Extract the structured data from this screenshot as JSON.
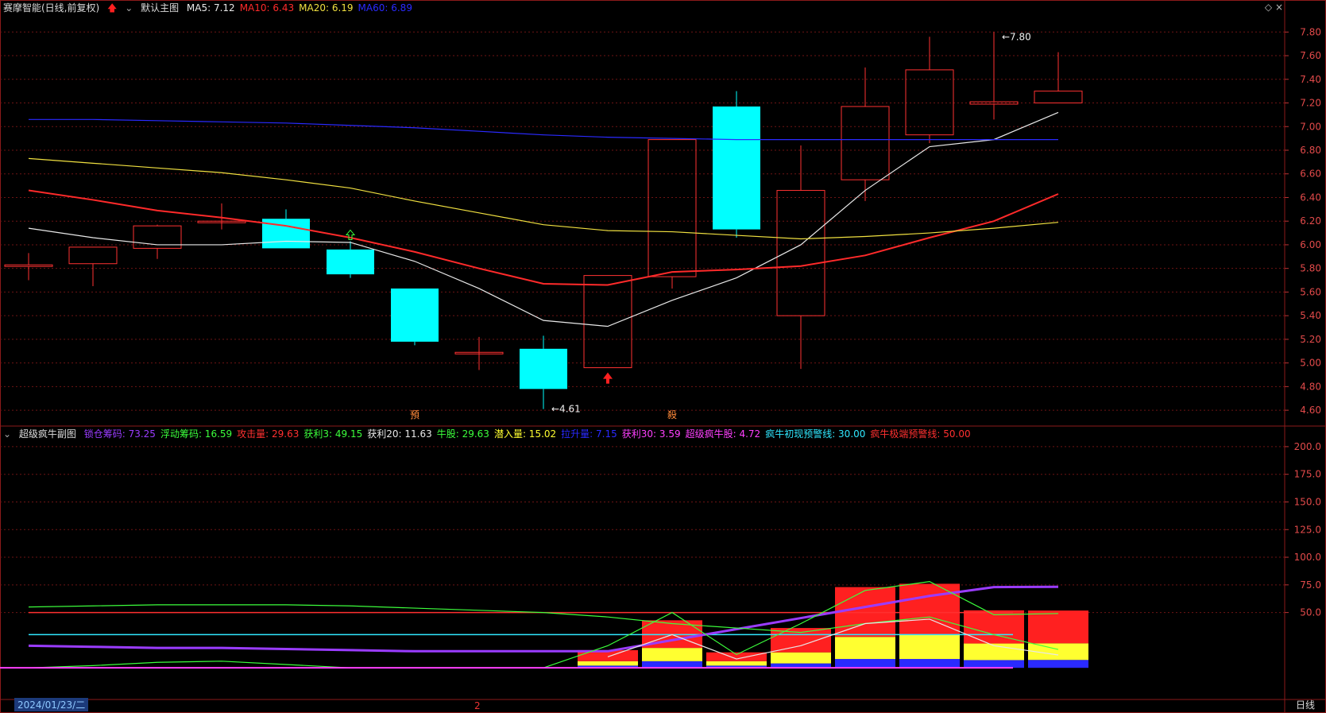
{
  "main_header": {
    "stock_title": "赛摩智能(日线,前复权)",
    "chart_name": "默认主图",
    "indicators": [
      {
        "label": "MA5: 7.12",
        "color": "#e8e8e8"
      },
      {
        "label": "MA10: 6.43",
        "color": "#ff2a2a"
      },
      {
        "label": "MA20: 6.19",
        "color": "#f0e040"
      },
      {
        "label": "MA60: 6.89",
        "color": "#2a2aff"
      }
    ]
  },
  "sub_header": {
    "chart_name": "超级疯牛副图",
    "indicators": [
      {
        "label": "锁仓筹码: 73.25",
        "color": "#9a3cff"
      },
      {
        "label": "浮动筹码: 16.59",
        "color": "#3cff3c"
      },
      {
        "label": "攻击量: 29.63",
        "color": "#ff3030"
      },
      {
        "label": "获利3: 49.15",
        "color": "#3cff3c"
      },
      {
        "label": "获利20: 11.63",
        "color": "#e8e8e8"
      },
      {
        "label": "牛股: 29.63",
        "color": "#3cff3c"
      },
      {
        "label": "潜入量: 15.02",
        "color": "#ffff30"
      },
      {
        "label": "拉升量: 7.15",
        "color": "#2a2aff"
      },
      {
        "label": "获利30: 3.59",
        "color": "#ff40ff"
      },
      {
        "label": "超级疯牛股: 4.72",
        "color": "#ff40ff"
      },
      {
        "label": "疯牛初现预警线: 30.00",
        "color": "#30e8ff"
      },
      {
        "label": "疯牛极端预警线: 50.00",
        "color": "#ff3030"
      }
    ]
  },
  "footer": {
    "date": "2024/01/23/二",
    "period_mark": "2",
    "period": "日线"
  },
  "chart_data": [
    {
      "type": "candlestick",
      "y_axis_ticks": [
        "7.80",
        "7.60",
        "7.40",
        "7.20",
        "7.00",
        "6.80",
        "6.60",
        "6.40",
        "6.20",
        "6.00",
        "5.80",
        "5.60",
        "5.40",
        "5.20",
        "5.00",
        "4.80",
        "4.60"
      ],
      "ylim": [
        4.52,
        7.95
      ],
      "candles": [
        {
          "o": 5.82,
          "h": 5.93,
          "l": 5.7,
          "c": 5.83
        },
        {
          "o": 5.84,
          "h": 5.98,
          "l": 5.65,
          "c": 5.98
        },
        {
          "o": 5.97,
          "h": 6.17,
          "l": 5.88,
          "c": 6.16
        },
        {
          "o": 6.2,
          "h": 6.35,
          "l": 6.13,
          "c": 6.2
        },
        {
          "o": 6.22,
          "h": 6.3,
          "l": 5.97,
          "c": 5.97
        },
        {
          "o": 5.96,
          "h": 6.03,
          "l": 5.72,
          "c": 5.75
        },
        {
          "o": 5.63,
          "h": 5.63,
          "l": 5.15,
          "c": 5.18
        },
        {
          "o": 5.09,
          "h": 5.22,
          "l": 4.94,
          "c": 5.09
        },
        {
          "o": 5.12,
          "h": 5.23,
          "l": 4.61,
          "c": 4.78
        },
        {
          "o": 4.96,
          "h": 5.74,
          "l": 4.96,
          "c": 5.74
        },
        {
          "o": 5.73,
          "h": 6.89,
          "l": 5.63,
          "c": 6.89
        },
        {
          "o": 7.17,
          "h": 7.3,
          "l": 6.06,
          "c": 6.13
        },
        {
          "o": 5.4,
          "h": 6.84,
          "l": 4.95,
          "c": 6.46
        },
        {
          "o": 6.55,
          "h": 7.5,
          "l": 6.37,
          "c": 7.17
        },
        {
          "o": 6.93,
          "h": 7.76,
          "l": 6.86,
          "c": 7.48
        },
        {
          "o": 7.19,
          "h": 7.8,
          "l": 7.06,
          "c": 7.21
        },
        {
          "o": 7.2,
          "h": 7.63,
          "l": 7.2,
          "c": 7.3
        }
      ],
      "series": [
        {
          "name": "MA5",
          "color": "#e8e8e8",
          "values": [
            6.14,
            6.06,
            6.0,
            6.0,
            6.03,
            6.02,
            5.86,
            5.63,
            5.36,
            5.31,
            5.53,
            5.72,
            6.0,
            6.46,
            6.83,
            6.89,
            7.12
          ]
        },
        {
          "name": "MA10",
          "color": "#ff2a2a",
          "values": [
            6.46,
            6.38,
            6.29,
            6.23,
            6.16,
            6.06,
            5.94,
            5.8,
            5.67,
            5.66,
            5.77,
            5.79,
            5.82,
            5.91,
            6.06,
            6.2,
            6.43
          ]
        },
        {
          "name": "MA20",
          "color": "#f0e040",
          "values": [
            6.73,
            6.69,
            6.65,
            6.61,
            6.55,
            6.48,
            6.37,
            6.27,
            6.17,
            6.12,
            6.11,
            6.08,
            6.05,
            6.07,
            6.1,
            6.14,
            6.19
          ]
        },
        {
          "name": "MA60",
          "color": "#2a2aff",
          "values": [
            7.06,
            7.06,
            7.05,
            7.04,
            7.03,
            7.01,
            6.99,
            6.96,
            6.93,
            6.91,
            6.9,
            6.89,
            6.89,
            6.89,
            6.89,
            6.89,
            6.89
          ]
        }
      ],
      "annotations": [
        {
          "text": "7.80",
          "at_candle": 15,
          "price": 7.8
        },
        {
          "text": "4.61",
          "at_candle": 8,
          "price": 4.61
        },
        {
          "text": "預",
          "at_candle": 6,
          "position": "below"
        },
        {
          "text": "殺",
          "at_candle": 10,
          "position": "below"
        }
      ],
      "signals": [
        {
          "kind": "buy-arrow",
          "at_candle": 9,
          "color": "#ff2020"
        },
        {
          "kind": "green-arrow",
          "at_candle": 5,
          "color": "#3cff3c"
        }
      ]
    },
    {
      "type": "line",
      "y_axis_ticks": [
        "200.0",
        "175.0",
        "150.0",
        "125.0",
        "100.0",
        "75.0",
        "50.0"
      ],
      "ylim": [
        -20,
        210
      ],
      "reference_lines": [
        {
          "name": "疯牛极端预警线",
          "value": 50,
          "color": "#ff3030"
        },
        {
          "name": "疯牛初现预警线",
          "value": 30,
          "color": "#30e8ff"
        }
      ],
      "series": [
        {
          "name": "锁仓筹码",
          "color": "#9a3cff",
          "values": [
            20,
            19,
            18,
            18,
            17,
            16,
            15,
            15,
            15,
            15,
            25,
            35,
            45,
            55,
            65,
            73,
            73.25
          ]
        },
        {
          "name": "浮动筹码",
          "color": "#3cff3c",
          "values": [
            55,
            56,
            57,
            57,
            57,
            56,
            54,
            52,
            50,
            46,
            40,
            36,
            32,
            40,
            46,
            30,
            16.59
          ]
        },
        {
          "name": "获利3",
          "color": "#3cff3c",
          "values": [
            0,
            2,
            5,
            6,
            3,
            0,
            0,
            0,
            0,
            20,
            50,
            12,
            40,
            70,
            78,
            48,
            49.15
          ]
        },
        {
          "name": "获利20",
          "color": "#e8e8e8",
          "values": [
            null,
            null,
            null,
            null,
            null,
            null,
            null,
            null,
            null,
            10,
            30,
            8,
            20,
            40,
            44,
            20,
            11.63
          ]
        }
      ],
      "bars": {
        "start_candle": 9,
        "stacks": [
          {
            "red": 10,
            "yellow": 4,
            "blue": 2
          },
          {
            "red": 25,
            "yellow": 12,
            "blue": 6
          },
          {
            "red": 8,
            "yellow": 4,
            "blue": 2
          },
          {
            "red": 22,
            "yellow": 10,
            "blue": 4
          },
          {
            "red": 45,
            "yellow": 20,
            "blue": 8
          },
          {
            "red": 46,
            "yellow": 22,
            "blue": 8
          },
          {
            "red": 30,
            "yellow": 15,
            "blue": 7
          },
          {
            "red": 29.63,
            "yellow": 15.02,
            "blue": 7.15
          }
        ]
      }
    }
  ]
}
